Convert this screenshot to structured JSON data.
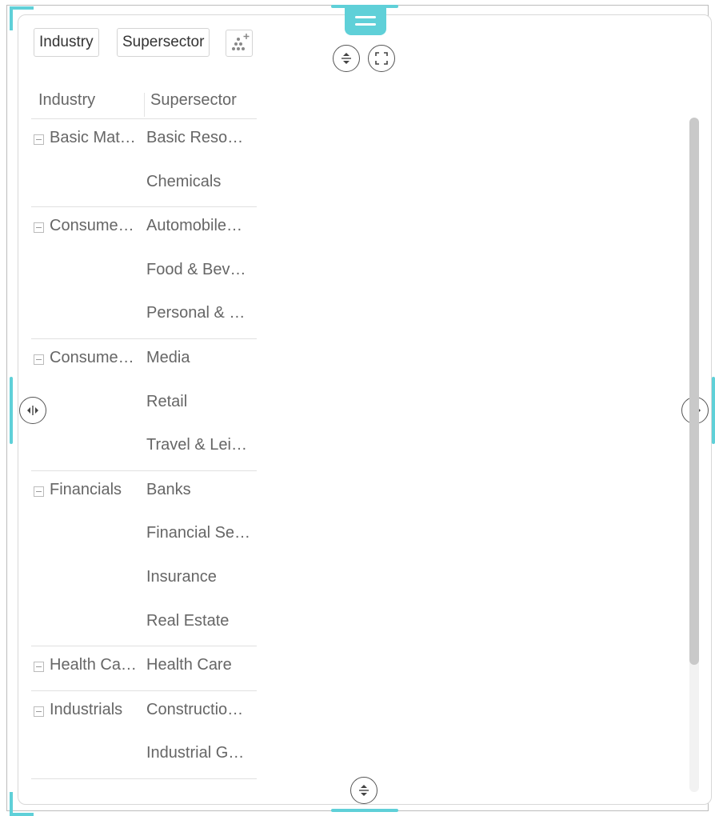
{
  "toolbar": {
    "chips": [
      "Industry",
      "Supersector"
    ],
    "add_icon": "scatter-plus-icon"
  },
  "controls": {
    "drag_icon": "hamburger-icon",
    "expand_collapse_icon": "expand-collapse-icon",
    "fullscreen_icon": "fullscreen-icon",
    "resize_icon": "resize-horizontal-icon",
    "accent_color": "#5fd0d8"
  },
  "grid": {
    "columns": [
      "Industry",
      "Supersector"
    ],
    "groups": [
      {
        "industry": "Basic Mat…",
        "supersectors": [
          "Basic Reso…",
          "Chemicals"
        ]
      },
      {
        "industry": "Consume…",
        "supersectors": [
          "Automobile…",
          "Food & Bev…",
          "Personal & …"
        ]
      },
      {
        "industry": "Consume…",
        "supersectors": [
          "Media",
          "Retail",
          "Travel & Lei…"
        ]
      },
      {
        "industry": "Financials",
        "supersectors": [
          "Banks",
          "Financial Se…",
          "Insurance",
          "Real Estate"
        ]
      },
      {
        "industry": "Health Ca…",
        "supersectors": [
          "Health Care"
        ]
      },
      {
        "industry": "Industrials",
        "supersectors": [
          "Constructio…",
          "Industrial G…"
        ]
      }
    ]
  }
}
